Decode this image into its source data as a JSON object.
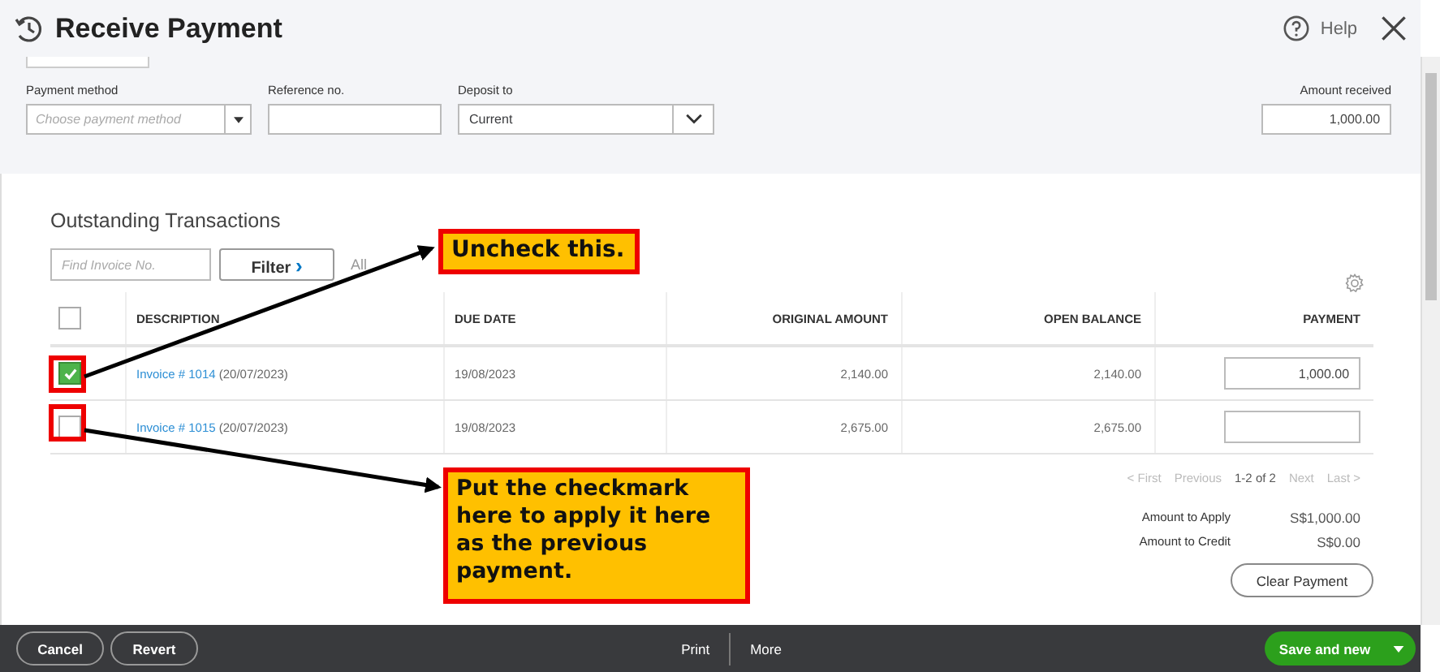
{
  "window": {
    "title": "Receive Payment",
    "help": "Help"
  },
  "form": {
    "payment_method": {
      "label": "Payment method",
      "placeholder": "Choose payment method"
    },
    "reference_no": {
      "label": "Reference no."
    },
    "deposit_to": {
      "label": "Deposit to",
      "value": "Current"
    },
    "amount_received": {
      "label": "Amount received",
      "value": "1,000.00"
    }
  },
  "outstanding": {
    "title": "Outstanding Transactions",
    "search_placeholder": "Find Invoice No.",
    "filter_button": "Filter",
    "filter_chevron": "›",
    "filter_value": "All",
    "columns": [
      "DESCRIPTION",
      "DUE DATE",
      "ORIGINAL AMOUNT",
      "OPEN BALANCE",
      "PAYMENT"
    ],
    "header_checked": false,
    "rows": [
      {
        "link": "Invoice # 1014",
        "date_note": "(20/07/2023)",
        "due_date": "19/08/2023",
        "original_amount": "2,140.00",
        "open_balance": "2,140.00",
        "payment": "1,000.00",
        "checked": true,
        "highlighted": true
      },
      {
        "link": "Invoice # 1015",
        "date_note": "(20/07/2023)",
        "due_date": "19/08/2023",
        "original_amount": "2,675.00",
        "open_balance": "2,675.00",
        "checked": false,
        "highlighted": true
      }
    ],
    "pager": {
      "first": "< First",
      "previous": "Previous",
      "range": "1-2 of 2",
      "next": "Next",
      "last": "Last >"
    },
    "totals": [
      {
        "label": "Amount to Apply",
        "value": "S$1,000.00"
      },
      {
        "label": "Amount to Credit",
        "value": "S$0.00"
      }
    ],
    "clear_button": "Clear Payment"
  },
  "footer": {
    "cancel": "Cancel",
    "revert": "Revert",
    "print": "Print",
    "more": "More",
    "save": "Save and new"
  },
  "annotations": [
    {
      "kind": "callout",
      "text": "Uncheck this."
    },
    {
      "kind": "callout",
      "text": "Put the checkmark here to apply it here as the previous payment."
    }
  ]
}
